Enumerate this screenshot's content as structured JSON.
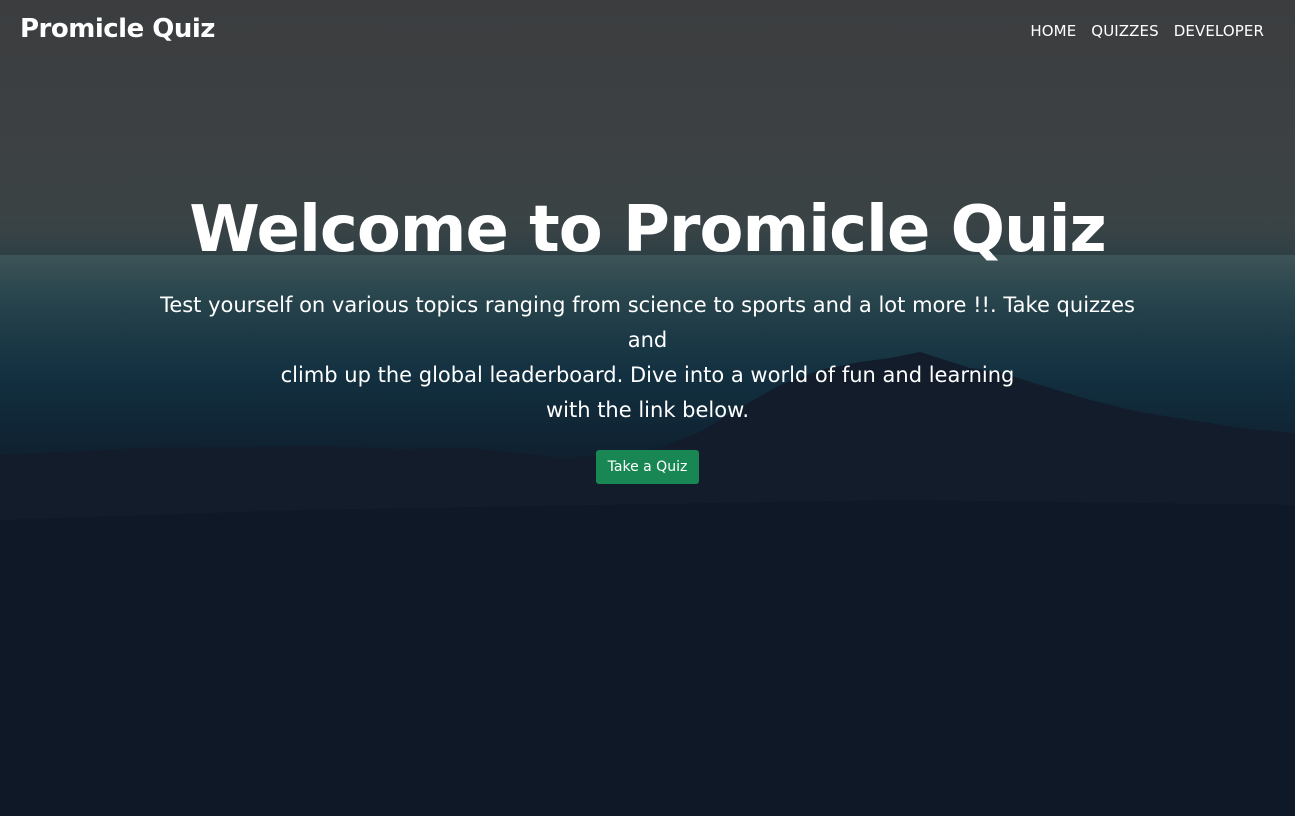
{
  "navbar": {
    "brand": "Promicle Quiz",
    "links": [
      "HOME",
      "QUIZZES",
      "DEVELOPER"
    ]
  },
  "hero": {
    "title": "Welcome to Promicle Quiz",
    "lines": [
      "Test yourself on various topics ranging from science to sports and a lot more !!. Take quizzes and",
      "climb up the global leaderboard. Dive into a world of fun and learning",
      "with the link below."
    ],
    "cta_label": "Take a Quiz"
  },
  "colors": {
    "cta_background": "#198754",
    "text": "#ffffff"
  }
}
